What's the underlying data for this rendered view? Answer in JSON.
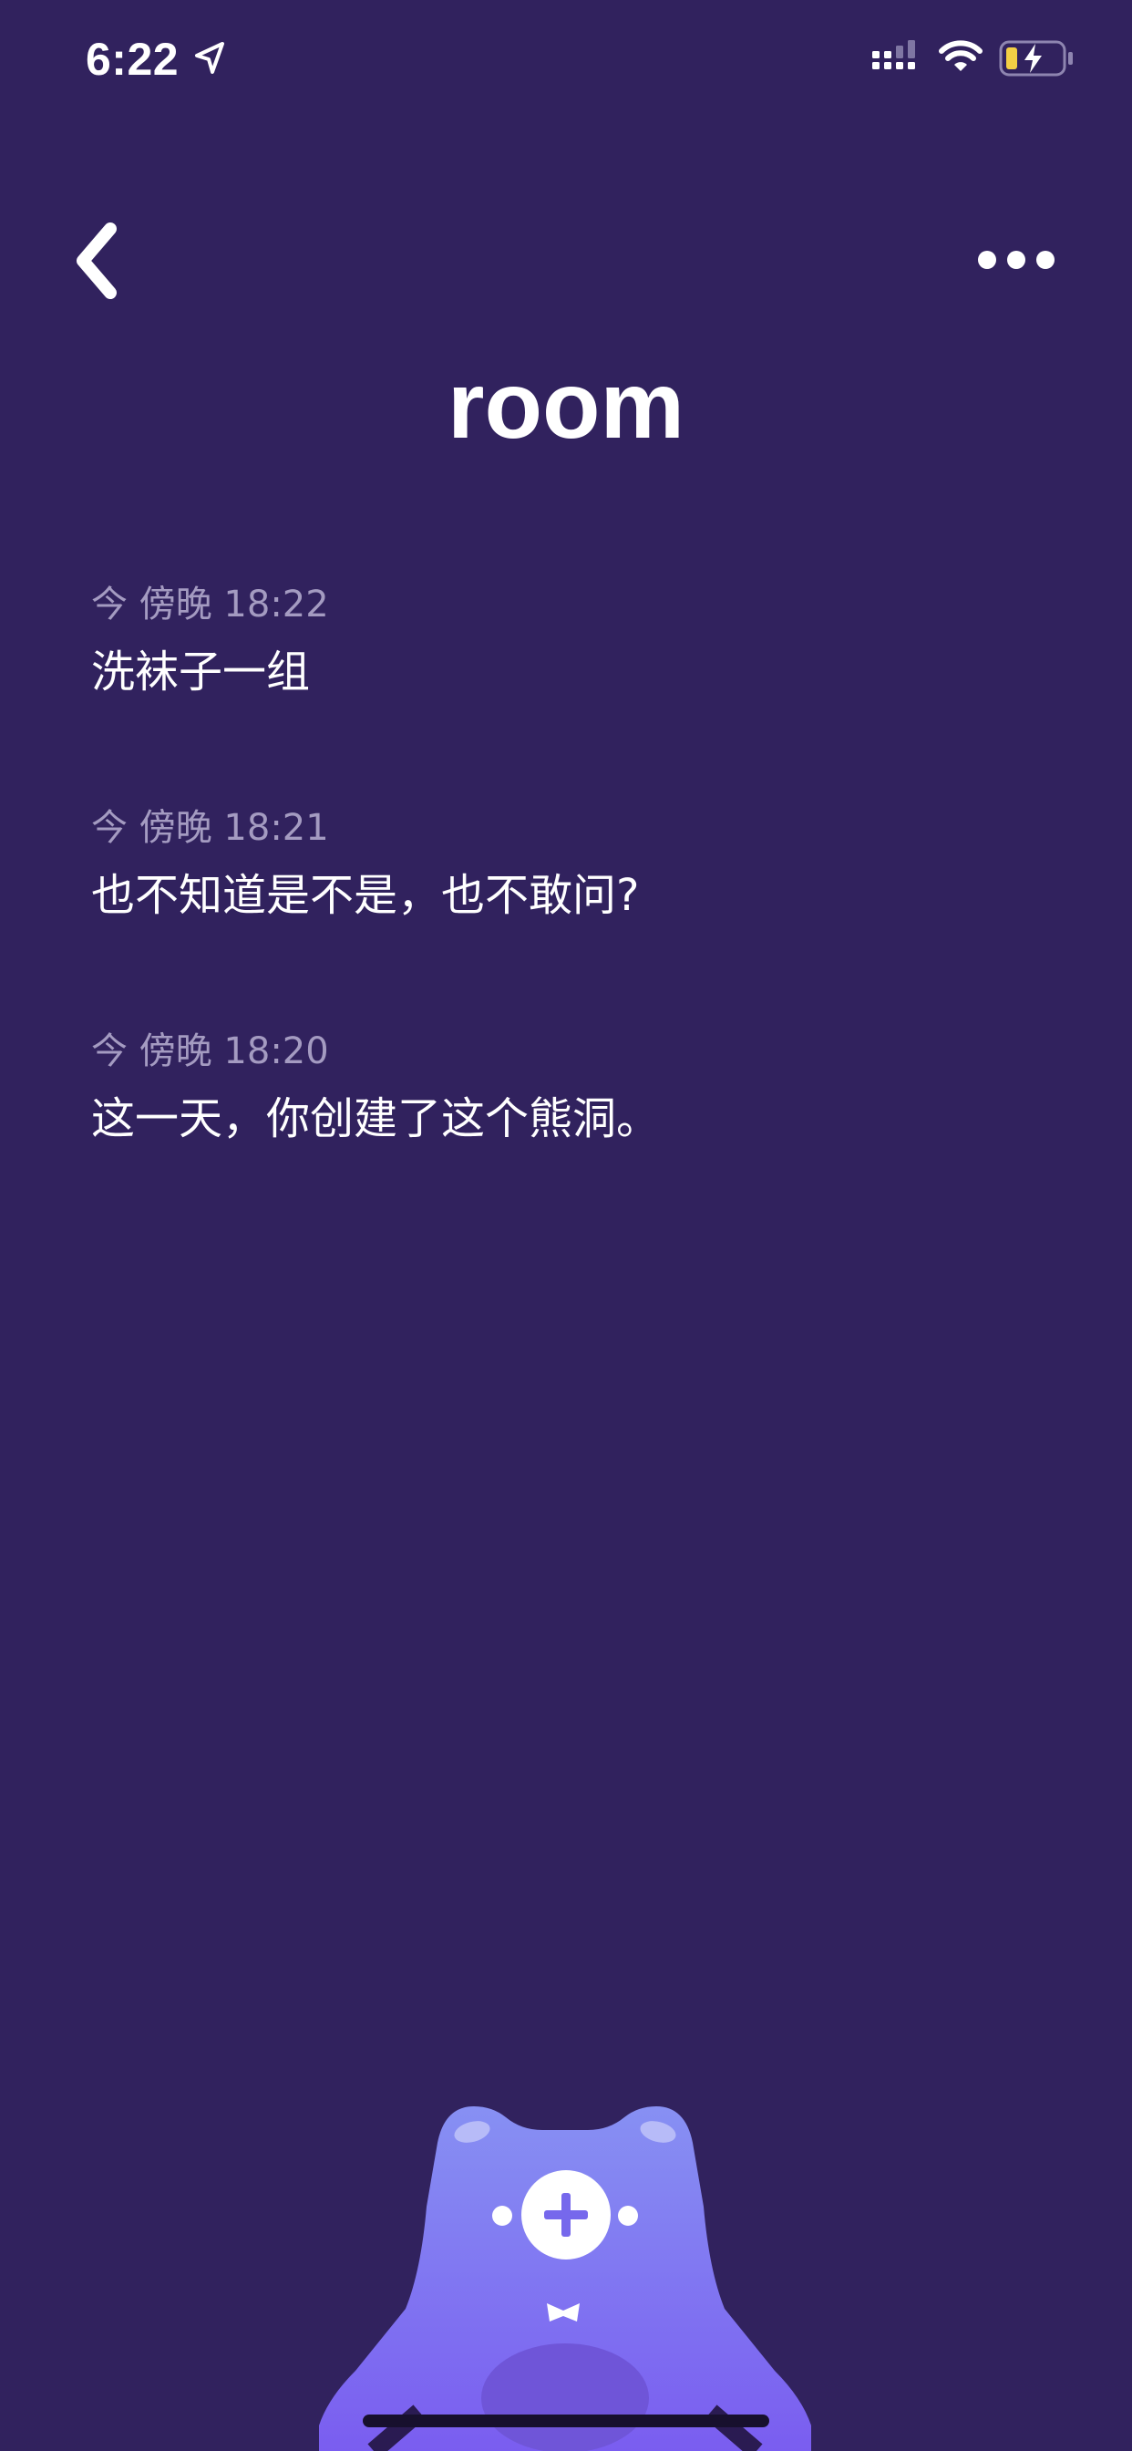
{
  "status_bar": {
    "time": "6:22",
    "icons": [
      "location-arrow-icon",
      "cellular-signal-icon",
      "wifi-icon",
      "battery-charging-icon"
    ]
  },
  "header": {
    "back_icon": "chevron-left-icon",
    "more_icon": "more-dots-icon",
    "title": "room"
  },
  "entries": [
    {
      "time": "今 傍晚 18:22",
      "text": "洗袜子一组"
    },
    {
      "time": "今 傍晚 18:21",
      "text": "也不知道是不是，也不敢问?"
    },
    {
      "time": "今 傍晚 18:20",
      "text": "这一天，你创建了这个熊洞。"
    }
  ],
  "bear_button": {
    "icon": "plus-icon",
    "bowtie_icon": "bowtie-icon"
  },
  "colors": {
    "background": "#31225e",
    "secondary_text": "#a49bc1",
    "bear_top": "#8790f3",
    "bear_bottom": "#7a5df0",
    "accent_plus": "#7668ec",
    "battery_fill": "#f3cf45"
  }
}
